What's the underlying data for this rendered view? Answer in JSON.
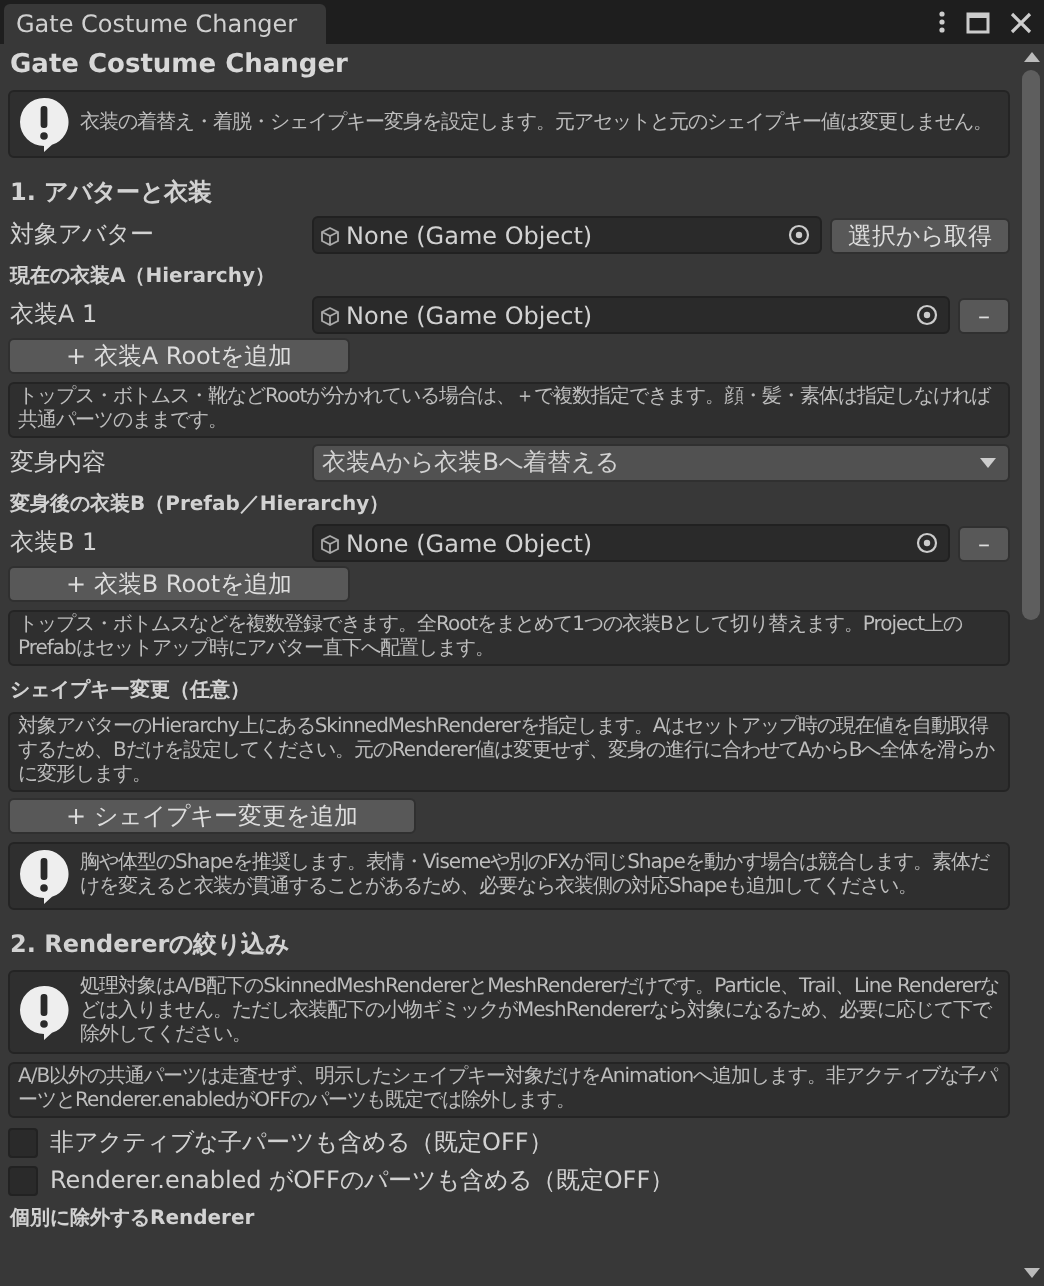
{
  "window": {
    "tab": "Gate Costume Changer"
  },
  "items": [
    {
      "kind": "title",
      "text": "Gate Costume Changer"
    },
    {
      "kind": "warning",
      "text": "衣装の着替え・着脱・シェイプキー変身を設定します。元アセットと元のシェイプキー値は変更しません。"
    },
    {
      "kind": "section",
      "text": "1. アバターと衣装"
    },
    {
      "kind": "object",
      "label": "対象アバター",
      "value": "None (Game Object)",
      "button": "選択から取得"
    },
    {
      "kind": "subheader",
      "text": "現在の衣装A（Hierarchy）"
    },
    {
      "kind": "object",
      "label": "衣装A 1",
      "value": "None (Game Object)",
      "button": "–"
    },
    {
      "kind": "add",
      "text": "+ 衣装A Rootを追加"
    },
    {
      "kind": "help",
      "text": "トップス・ボトムス・靴などRootが分かれている場合は、＋で複数指定できます。顔・髪・素体は指定しなければ共通パーツのままです。"
    },
    {
      "kind": "dropdown",
      "label": "変身内容",
      "value": "衣装Aから衣装Bへ着替える"
    },
    {
      "kind": "subheader",
      "text": "変身後の衣装B（Prefab／Hierarchy）"
    },
    {
      "kind": "object",
      "label": "衣装B 1",
      "value": "None (Game Object)",
      "button": "–"
    },
    {
      "kind": "add",
      "text": "+ 衣装B Rootを追加"
    },
    {
      "kind": "help",
      "text": "トップス・ボトムスなどを複数登録できます。全Rootをまとめて1つの衣装Bとして切り替えます。Project上のPrefabはセットアップ時にアバター直下へ配置します。"
    },
    {
      "kind": "subheader",
      "text": "シェイプキー変更（任意）"
    },
    {
      "kind": "help",
      "text": "対象アバターのHierarchy上にあるSkinnedMeshRendererを指定します。Aはセットアップ時の現在値を自動取得するため、Bだけを設定してください。元のRenderer値は変更せず、変身の進行に合わせてAからBへ全体を滑らかに変形します。"
    },
    {
      "kind": "add",
      "text": "+ シェイプキー変更を追加"
    },
    {
      "kind": "warning",
      "text": "胸や体型のShapeを推奨します。表情・Visemeや別のFXが同じShapeを動かす場合は競合します。素体だけを変えると衣装が貫通することがあるため、必要なら衣装側の対応Shapeも追加してください。"
    },
    {
      "kind": "section",
      "text": "2. Rendererの絞り込み"
    },
    {
      "kind": "warning",
      "text": "処理対象はA/B配下のSkinnedMeshRendererとMeshRendererだけです。Particle、Trail、Line Rendererなどは入りません。ただし衣装配下の小物ギミックがMeshRendererなら対象になるため、必要に応じて下で除外してください。"
    },
    {
      "kind": "help",
      "text": "A/B以外の共通パーツは走査せず、明示したシェイプキー対象だけをAnimationへ追加します。非アクティブな子パーツとRenderer.enabledがOFFのパーツも既定では除外します。"
    },
    {
      "kind": "checkbox",
      "text": "非アクティブな子パーツも含める（既定OFF）",
      "checked": false
    },
    {
      "kind": "checkbox",
      "text": "Renderer.enabled がOFFのパーツも含める（既定OFF）",
      "checked": false
    },
    {
      "kind": "subheader",
      "text": "個別に除外するRenderer"
    }
  ]
}
